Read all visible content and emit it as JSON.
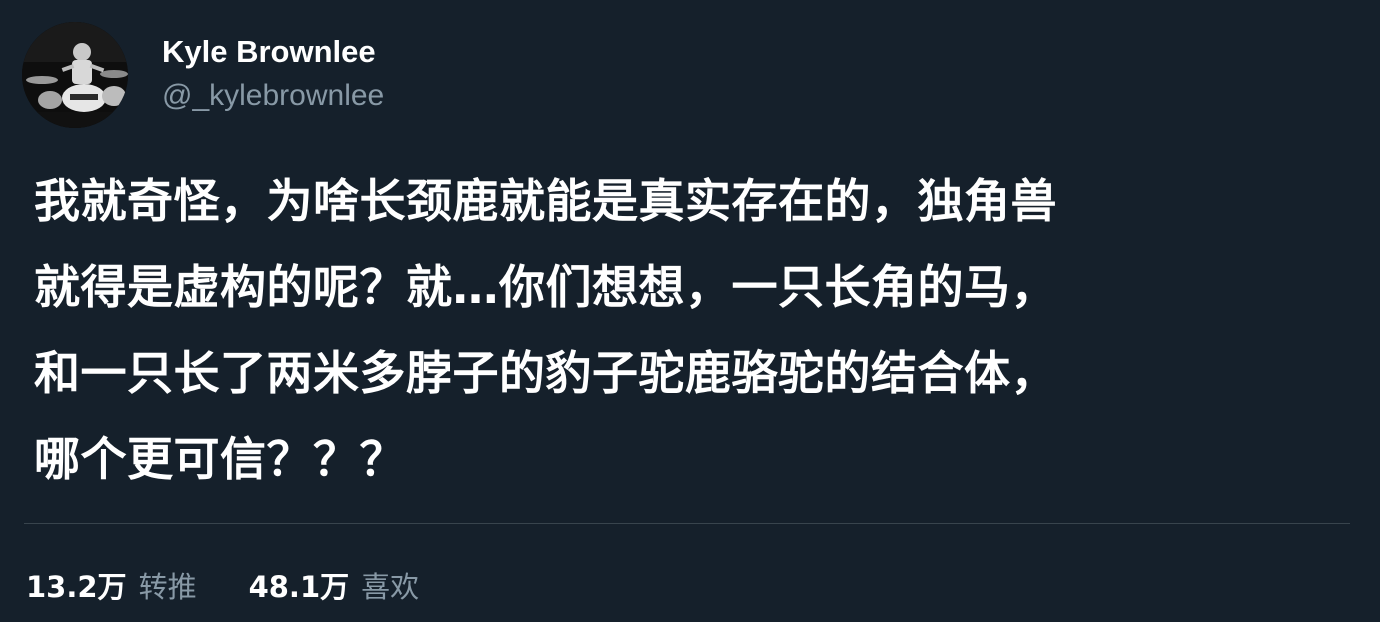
{
  "author": {
    "display_name": "Kyle Brownlee",
    "handle": "@_kylebrownlee",
    "avatar_icon": "avatar-photo-drummer"
  },
  "tweet": {
    "lines": [
      "我就奇怪，为啥长颈鹿就能是真实存在的，独角兽",
      "就得是虚构的呢？就…你们想想，一只长角的马，",
      "和一只长了两米多脖子的豹子驼鹿骆驼的结合体，",
      "哪个更可信？？？"
    ]
  },
  "stats": {
    "retweets": {
      "count": "13.2万",
      "label": "转推"
    },
    "likes": {
      "count": "48.1万",
      "label": "喜欢"
    }
  },
  "colors": {
    "background": "#15202b",
    "primary_text": "#ffffff",
    "secondary_text": "#8899a6",
    "divider": "#38444d"
  }
}
